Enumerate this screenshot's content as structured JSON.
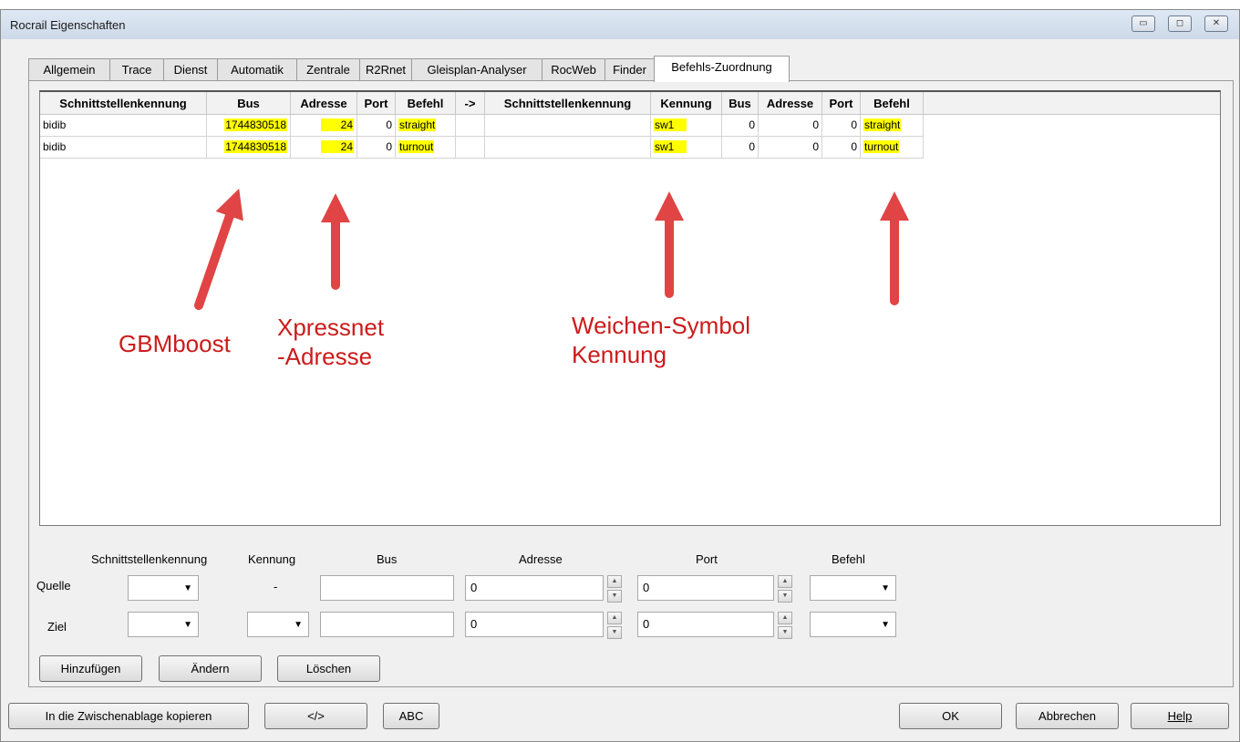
{
  "window": {
    "title": "Rocrail Eigenschaften"
  },
  "window_buttons": {
    "minimize": "▭",
    "maximize": "◻",
    "close": "✕"
  },
  "tabs": [
    {
      "label": "Allgemein"
    },
    {
      "label": "Trace"
    },
    {
      "label": "Dienst"
    },
    {
      "label": "Automatik"
    },
    {
      "label": "Zentrale"
    },
    {
      "label": "R2Rnet"
    },
    {
      "label": "Gleisplan-Analyser"
    },
    {
      "label": "RocWeb"
    },
    {
      "label": "Finder"
    },
    {
      "label": "Befehls-Zuordnung",
      "active": true
    }
  ],
  "table": {
    "headers": [
      "Schnittstellenkennung",
      "Bus",
      "Adresse",
      "Port",
      "Befehl",
      "->",
      "Schnittstellenkennung",
      "Kennung",
      "Bus",
      "Adresse",
      "Port",
      "Befehl"
    ],
    "rows": [
      [
        "bidib",
        "1744830518",
        "24",
        "0",
        "straight",
        "",
        "",
        "sw1",
        "0",
        "0",
        "0",
        "straight"
      ],
      [
        "bidib",
        "1744830518",
        "24",
        "0",
        "turnout",
        "",
        "",
        "sw1",
        "0",
        "0",
        "0",
        "turnout"
      ]
    ],
    "highlight_color": "#ffff00"
  },
  "annotations": {
    "gbmboost": "GBMboost",
    "xpressnet_1": "Xpressnet",
    "xpressnet_2": "-Adresse",
    "weichen_1": "Weichen-Symbol",
    "weichen_2": "Kennung",
    "color": "#cc1b1b"
  },
  "form": {
    "col_labels": {
      "schnittstellenkennung": "Schnittstellenkennung",
      "kennung": "Kennung",
      "bus": "Bus",
      "adresse": "Adresse",
      "port": "Port",
      "befehl": "Befehl"
    },
    "quelle": {
      "label": "Quelle",
      "kennung": "-",
      "bus": "",
      "adresse": "0",
      "port": "0"
    },
    "ziel": {
      "label": "Ziel",
      "bus": "",
      "adresse": "0",
      "port": "0"
    }
  },
  "panel_buttons": {
    "add": "Hinzufügen",
    "modify": "Ändern",
    "delete": "Löschen"
  },
  "bottom_buttons": {
    "copy": "In die Zwischenablage kopieren",
    "code": "</>",
    "abc": "ABC",
    "ok": "OK",
    "cancel": "Abbrechen",
    "help": "Help"
  }
}
